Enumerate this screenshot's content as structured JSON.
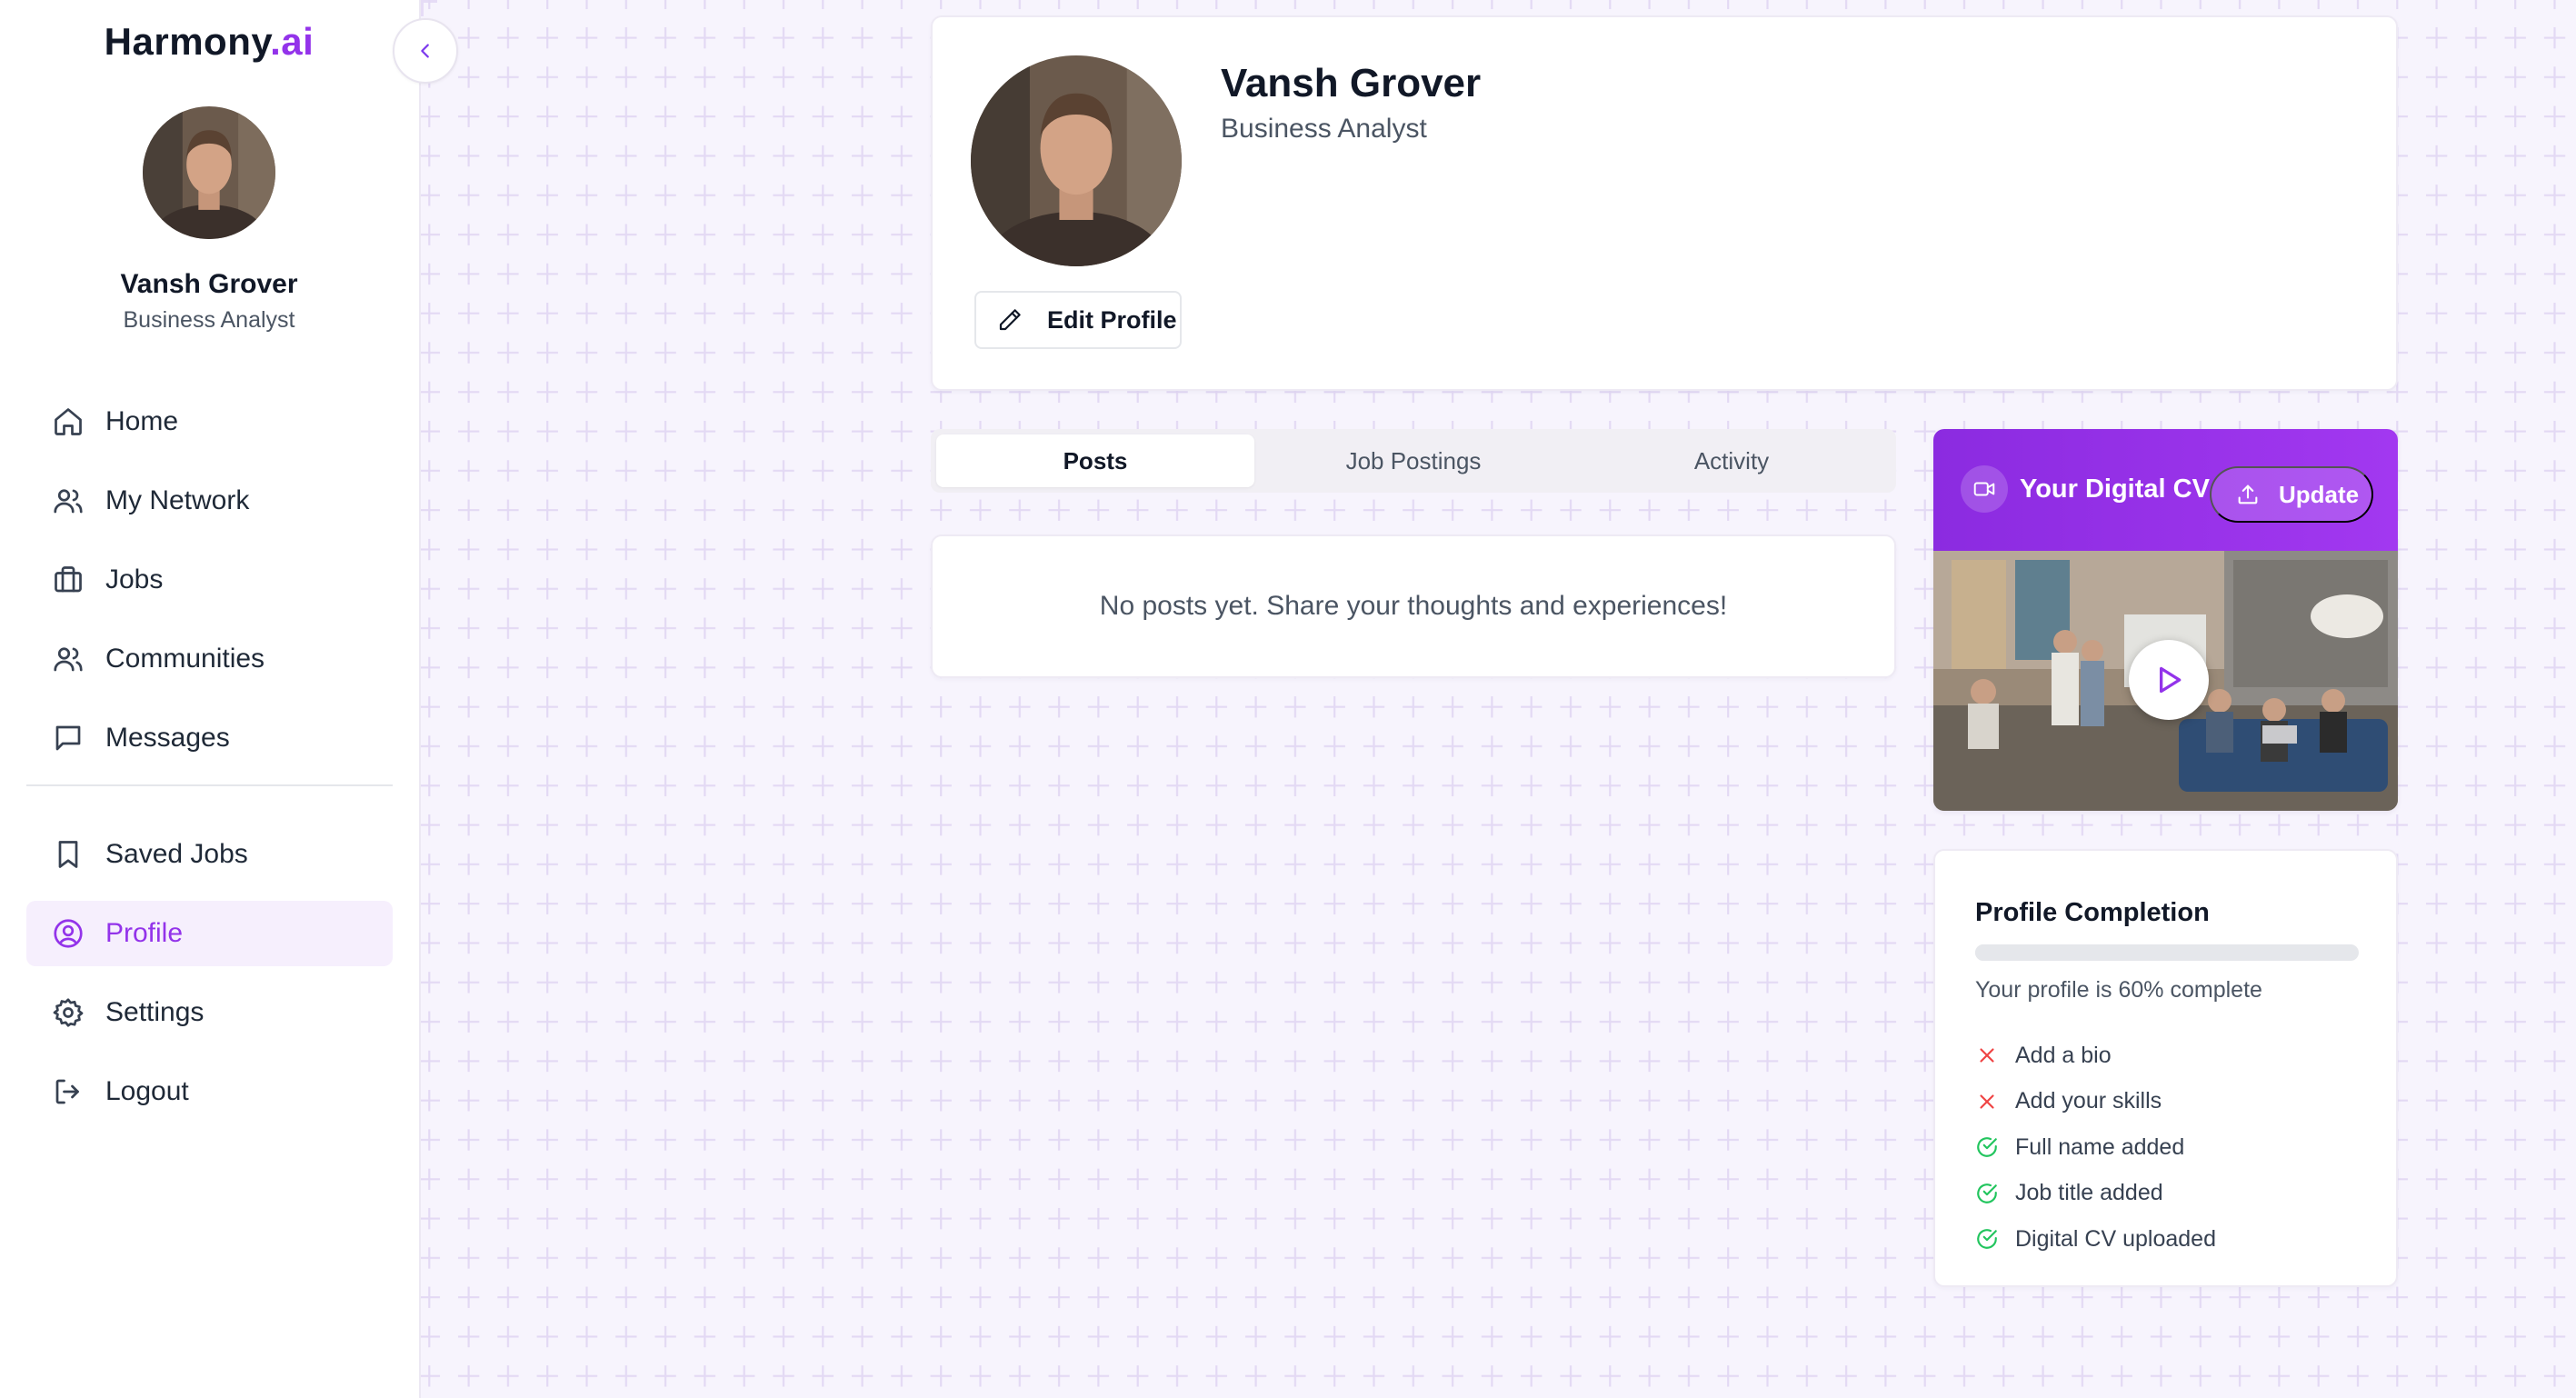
{
  "brand": {
    "name": "Harmony",
    "suffix": ".ai"
  },
  "user": {
    "name": "Vansh Grover",
    "role": "Business Analyst"
  },
  "sidebar": {
    "items": [
      {
        "label": "Home",
        "icon": "home-icon"
      },
      {
        "label": "My Network",
        "icon": "users-icon"
      },
      {
        "label": "Jobs",
        "icon": "briefcase-icon"
      },
      {
        "label": "Communities",
        "icon": "users-icon"
      },
      {
        "label": "Messages",
        "icon": "message-icon"
      }
    ],
    "secondary": [
      {
        "label": "Saved Jobs",
        "icon": "bookmark-icon"
      },
      {
        "label": "Profile",
        "icon": "user-circle-icon",
        "active": true
      },
      {
        "label": "Settings",
        "icon": "gear-icon"
      },
      {
        "label": "Logout",
        "icon": "logout-icon"
      }
    ]
  },
  "profile": {
    "name": "Vansh Grover",
    "role": "Business Analyst",
    "edit_label": "Edit Profile"
  },
  "tabs": [
    {
      "label": "Posts",
      "active": true
    },
    {
      "label": "Job Postings",
      "active": false
    },
    {
      "label": "Activity",
      "active": false
    }
  ],
  "posts": {
    "empty_text": "No posts yet. Share your thoughts and experiences!"
  },
  "cv": {
    "title": "Your Digital CV",
    "update_label": "Update"
  },
  "completion": {
    "title": "Profile Completion",
    "percent": 60,
    "status_text": "Your profile is 60% complete",
    "items": [
      {
        "label": "Add a bio",
        "done": false
      },
      {
        "label": "Add your skills",
        "done": false
      },
      {
        "label": "Full name added",
        "done": true
      },
      {
        "label": "Job title added",
        "done": true
      },
      {
        "label": "Digital CV uploaded",
        "done": true
      }
    ]
  },
  "colors": {
    "accent": "#9333ea",
    "background": "#f7f4fd",
    "success": "#22c55e",
    "danger": "#ef4444"
  }
}
